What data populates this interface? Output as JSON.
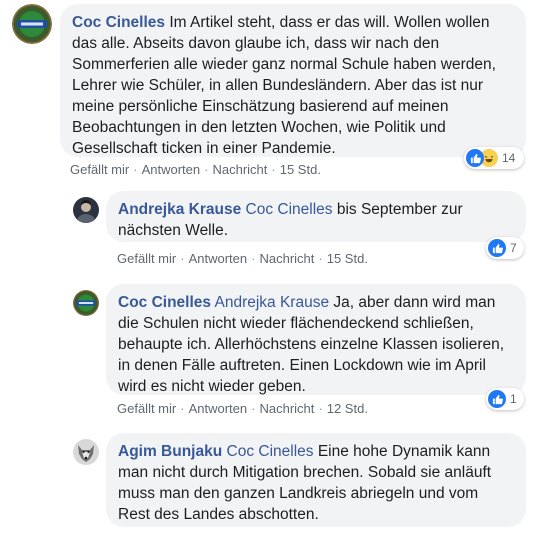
{
  "comments": [
    {
      "author": "Coc Cinelles",
      "mention": "",
      "text": "Im Artikel steht, dass er das will. Wollen wollen das alle. Abseits davon glaube ich, dass wir nach den Sommerferien alle wieder ganz normal Schule haben werden, Lehrer wie Schüler, in allen Bundesländern. Aber das ist nur meine persönliche Einschätzung basierend auf meinen Beobachtungen in den letzten Wochen, wie Politik und Gesellschaft ticken in einer Pandemie.",
      "time": "15 Std.",
      "reaction_count": "14",
      "reaction_icons": [
        "like-icon",
        "haha-icon"
      ]
    },
    {
      "author": "Andrejka Krause",
      "mention": "Coc Cinelles",
      "text": "bis September zur nächsten Welle.",
      "time": "15 Std.",
      "reaction_count": "7",
      "reaction_icons": [
        "like-icon"
      ]
    },
    {
      "author": "Coc Cinelles",
      "mention": "Andrejka Krause",
      "text": "Ja, aber dann wird man die Schulen nicht wieder flächendeckend schließen, behaupte ich. Allerhöchstens einzelne Klassen isolieren, in denen Fälle auftreten. Einen Lockdown wie im April wird es nicht wieder geben.",
      "time": "12 Std.",
      "reaction_count": "1",
      "reaction_icons": [
        "like-icon"
      ]
    },
    {
      "author": "Agim Bunjaku",
      "mention": "Coc Cinelles",
      "text": "Eine hohe Dynamik kann man nicht durch Mitigation brechen. Sobald sie anläuft muss man den ganzen Landkreis abriegeln und vom Rest des Landes abschotten.",
      "time": "",
      "reaction_count": "",
      "reaction_icons": []
    }
  ],
  "actions": {
    "like": "Gefällt mir",
    "reply": "Antworten",
    "message": "Nachricht",
    "separator": "·"
  },
  "colors": {
    "link": "#385898",
    "bubble": "#f2f3f5",
    "meta": "#606770",
    "like": "#2078f4"
  }
}
